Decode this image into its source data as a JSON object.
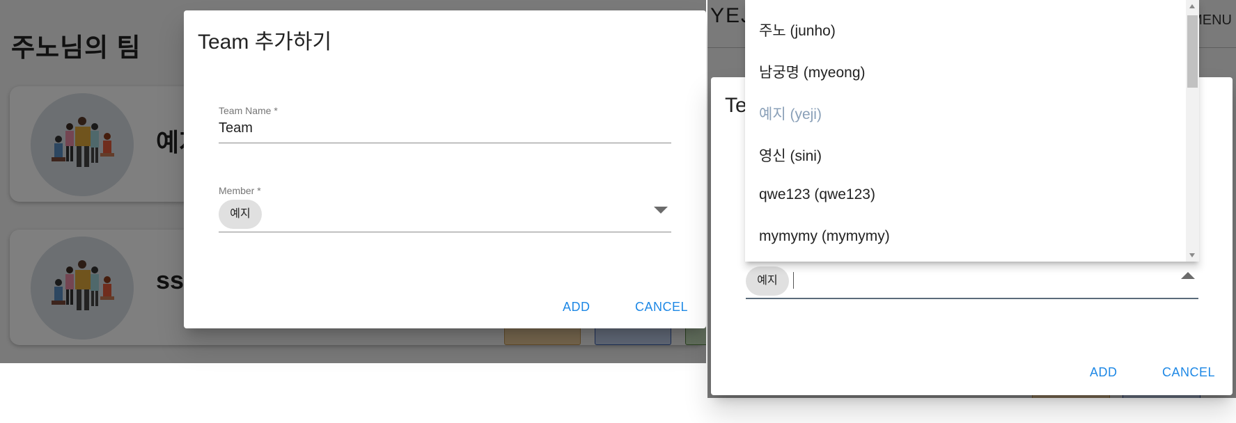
{
  "left": {
    "page_title": "주노님의 팀",
    "cards": [
      {
        "name": "예지"
      },
      {
        "name": "ss"
      }
    ],
    "dialog": {
      "title": "Team 추가하기",
      "team_name_label": "Team Name *",
      "team_name_value": "Team",
      "member_label": "Member *",
      "member_chip": "예지",
      "add_label": "ADD",
      "cancel_label": "CANCEL"
    }
  },
  "right": {
    "header_text": "YEJI",
    "menu_label": "MENU",
    "dialog": {
      "title": "Te",
      "member_chip": "예지",
      "add_label": "ADD",
      "cancel_label": "CANCEL"
    },
    "options": [
      {
        "label": "주노 (junho)",
        "selected": false
      },
      {
        "label": "남궁명 (myeong)",
        "selected": false
      },
      {
        "label": "예지 (yeji)",
        "selected": true
      },
      {
        "label": "영신 (sini)",
        "selected": false
      },
      {
        "label": "qwe123 (qwe123)",
        "selected": false
      },
      {
        "label": "mymymy (mymymy)",
        "selected": false
      }
    ]
  },
  "colors": {
    "accent": "#1e88e5",
    "selected_option": "#8aa0b8",
    "chip_bg": "#e0e0e0"
  },
  "icons": [
    "team-illustration-icon",
    "dropdown-arrow-icon",
    "scroll-up-icon",
    "scroll-down-icon"
  ]
}
